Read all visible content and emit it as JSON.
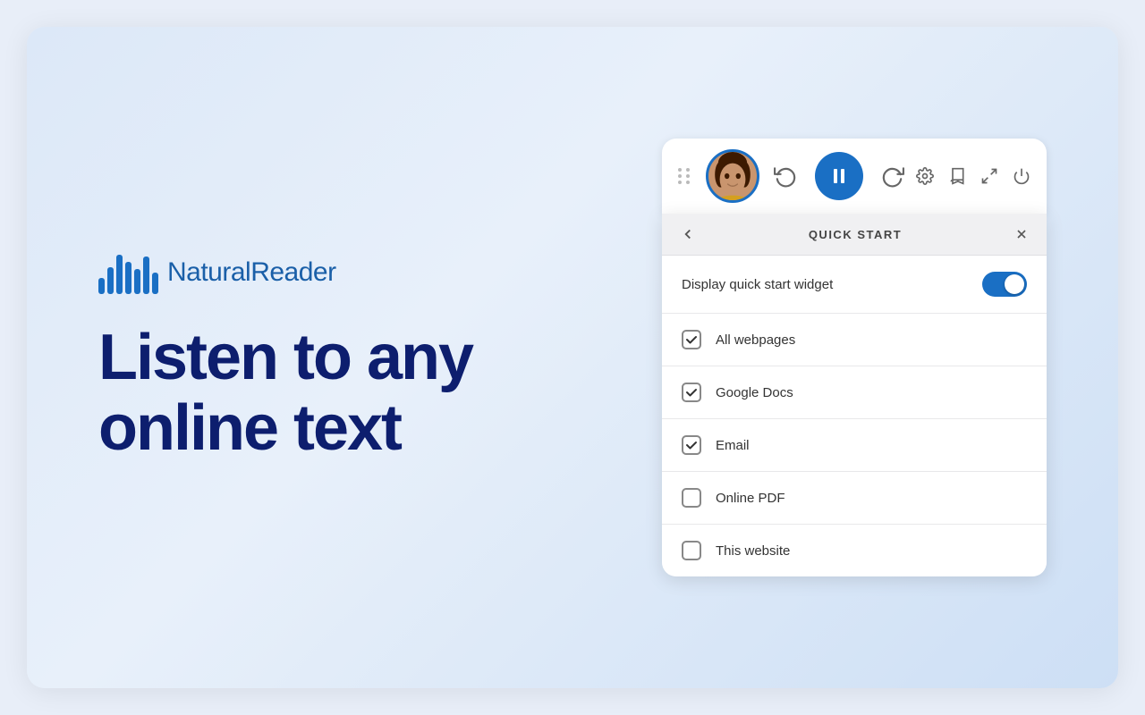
{
  "logo": {
    "text": "NaturalReader",
    "n_prefix": "N"
  },
  "hero": {
    "line1": "Listen to any",
    "line2": "online text"
  },
  "player": {
    "rewind_label": "⟲",
    "pause_label": "⏸",
    "forward_label": "⟳"
  },
  "toolbar": {
    "settings_icon": "⚙",
    "bookmark_icon": "🔖",
    "expand_icon": "⤢",
    "power_icon": "⏻"
  },
  "quick_start": {
    "title": "QUICK START",
    "back_icon": "‹",
    "close_icon": "✕",
    "toggle_label": "Display quick start widget",
    "toggle_on": true,
    "checkboxes": [
      {
        "label": "All webpages",
        "checked": true
      },
      {
        "label": "Google Docs",
        "checked": true
      },
      {
        "label": "Email",
        "checked": true
      },
      {
        "label": "Online PDF",
        "checked": false
      },
      {
        "label": "This website",
        "checked": false
      }
    ]
  }
}
